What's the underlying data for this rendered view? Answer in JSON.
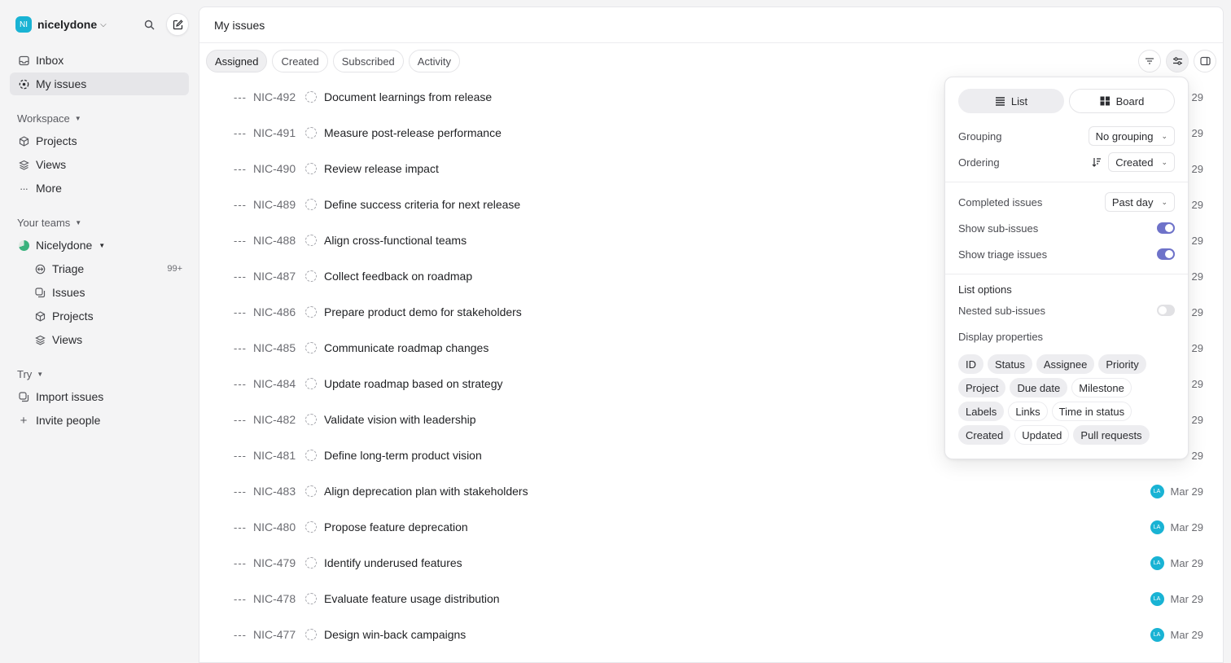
{
  "workspace": {
    "initials": "NI",
    "name": "nicelydone"
  },
  "nav": {
    "inbox": "Inbox",
    "my_issues": "My issues",
    "workspace_title": "Workspace",
    "projects": "Projects",
    "views": "Views",
    "more": "More",
    "teams_title": "Your teams",
    "team_name": "Nicelydone",
    "triage": "Triage",
    "triage_badge": "99+",
    "issues": "Issues",
    "team_projects": "Projects",
    "team_views": "Views",
    "try_title": "Try",
    "import_issues": "Import issues",
    "invite_people": "Invite people"
  },
  "page": {
    "title": "My issues",
    "tabs": [
      "Assigned",
      "Created",
      "Subscribed",
      "Activity"
    ],
    "active_tab": "Assigned"
  },
  "issues": [
    {
      "id": "NIC-492",
      "title": "Document learnings from release",
      "date": "29",
      "assignee": ""
    },
    {
      "id": "NIC-491",
      "title": "Measure post-release performance",
      "date": "29",
      "assignee": ""
    },
    {
      "id": "NIC-490",
      "title": "Review release impact",
      "date": "29",
      "assignee": ""
    },
    {
      "id": "NIC-489",
      "title": "Define success criteria for next release",
      "date": "29",
      "assignee": ""
    },
    {
      "id": "NIC-488",
      "title": "Align cross-functional teams",
      "date": "29",
      "assignee": ""
    },
    {
      "id": "NIC-487",
      "title": "Collect feedback on roadmap",
      "date": "29",
      "assignee": ""
    },
    {
      "id": "NIC-486",
      "title": "Prepare product demo for stakeholders",
      "date": "29",
      "assignee": ""
    },
    {
      "id": "NIC-485",
      "title": "Communicate roadmap changes",
      "date": "29",
      "assignee": ""
    },
    {
      "id": "NIC-484",
      "title": "Update roadmap based on strategy",
      "date": "29",
      "assignee": ""
    },
    {
      "id": "NIC-482",
      "title": "Validate vision with leadership",
      "date": "29",
      "assignee": ""
    },
    {
      "id": "NIC-481",
      "title": "Define long-term product vision",
      "date": "29",
      "assignee": ""
    },
    {
      "id": "NIC-483",
      "title": "Align deprecation plan with stakeholders",
      "date": "Mar 29",
      "assignee": "LA"
    },
    {
      "id": "NIC-480",
      "title": "Propose feature deprecation",
      "date": "Mar 29",
      "assignee": "LA"
    },
    {
      "id": "NIC-479",
      "title": "Identify underused features",
      "date": "Mar 29",
      "assignee": "LA"
    },
    {
      "id": "NIC-478",
      "title": "Evaluate feature usage distribution",
      "date": "Mar 29",
      "assignee": "LA"
    },
    {
      "id": "NIC-477",
      "title": "Design win-back campaigns",
      "date": "Mar 29",
      "assignee": "LA"
    }
  ],
  "display_options": {
    "layout_list": "List",
    "layout_board": "Board",
    "grouping_label": "Grouping",
    "grouping_value": "No grouping",
    "ordering_label": "Ordering",
    "ordering_value": "Created",
    "completed_label": "Completed issues",
    "completed_value": "Past day",
    "show_sub_label": "Show sub-issues",
    "show_sub_on": true,
    "show_triage_label": "Show triage issues",
    "show_triage_on": true,
    "list_options_title": "List options",
    "nested_label": "Nested sub-issues",
    "nested_on": false,
    "display_props_label": "Display properties",
    "properties": [
      {
        "label": "ID",
        "on": true
      },
      {
        "label": "Status",
        "on": true
      },
      {
        "label": "Assignee",
        "on": true
      },
      {
        "label": "Priority",
        "on": true
      },
      {
        "label": "Project",
        "on": true
      },
      {
        "label": "Due date",
        "on": true
      },
      {
        "label": "Milestone",
        "on": false
      },
      {
        "label": "Labels",
        "on": true
      },
      {
        "label": "Links",
        "on": false
      },
      {
        "label": "Time in status",
        "on": false
      },
      {
        "label": "Created",
        "on": true
      },
      {
        "label": "Updated",
        "on": false
      },
      {
        "label": "Pull requests",
        "on": true
      }
    ]
  },
  "colors": {
    "accent": "#6e72c9",
    "avatar": "#19b3d4",
    "team": "#38b27c"
  }
}
